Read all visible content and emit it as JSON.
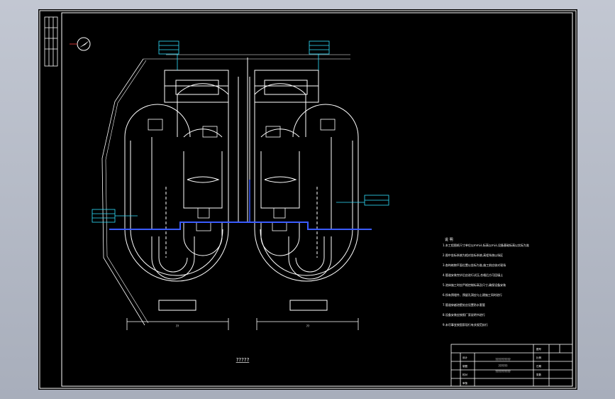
{
  "drawing": {
    "caption": "?????",
    "dimension_left": "??",
    "dimension_right": "??",
    "notes_heading": "说 明",
    "notes_lines": [
      "1.本工程图纸尺寸单位以mm计,标高以m计,设备基础标高以实际为准",
      "2.图中坐标系统为相对坐标系统,高程系统以场区",
      "3.各构筑物平面位置以坐标为准,施工前应核对现场",
      "4.管道安装完毕后应进行试压,合格后方可回填土",
      "5.池体施工时应严格控制标高及尺寸,确保设备安装",
      "6.所有预埋件、预留孔洞应与土建施工同时进行",
      "7.管道穿越池壁处应设置防水套管",
      "8.设备安装应按照厂家说明书进行",
      "9.未尽事宜按国家现行有关规范执行"
    ],
    "title_block": {
      "project": "??????????",
      "drawing_name": "??????",
      "drawing_no": "??????????",
      "rows": [
        "设计",
        "制图",
        "校对",
        "审核",
        "批准"
      ],
      "right_labels": [
        "图号",
        "比例",
        "日期",
        "张数"
      ]
    }
  }
}
